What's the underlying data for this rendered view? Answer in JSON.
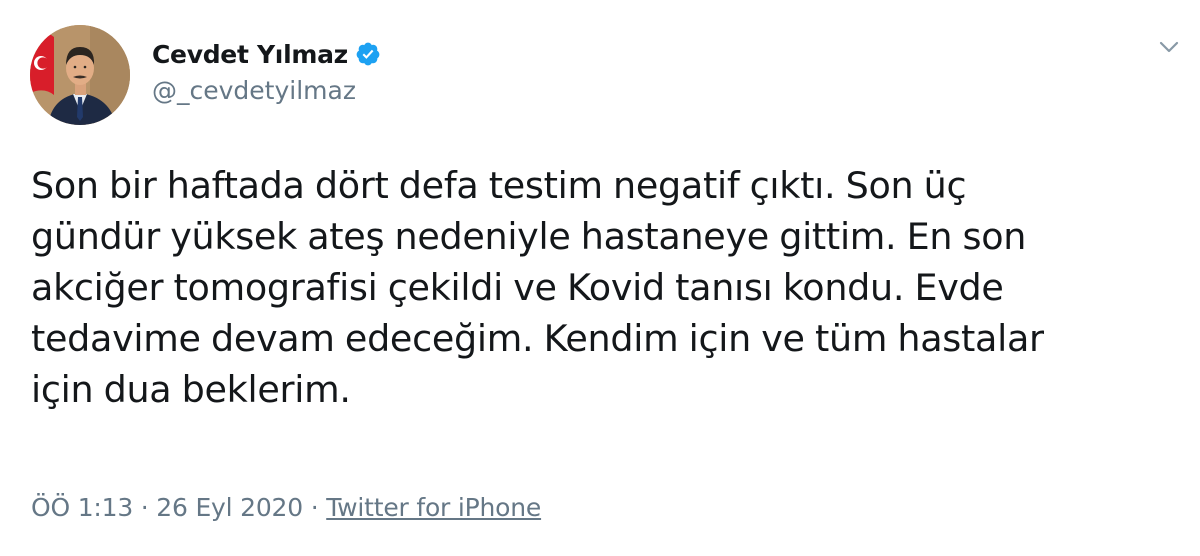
{
  "author": {
    "display_name": "Cevdet Yılmaz",
    "handle": "@_cevdetyilmaz",
    "verified": true,
    "avatar_icon": "user-avatar-photo"
  },
  "tweet": {
    "text": "Son bir haftada dört defa testim negatif çıktı. Son üç\ngündür yüksek ateş nedeniyle hastaneye gittim. En son\nakciğer tomografisi çekildi ve Kovid tanısı kondu. Evde\ntedavime devam edeceğim. Kendim için ve tüm hastalar\niçin dua beklerim."
  },
  "meta": {
    "time": "ÖÖ 1:13",
    "separator_1": " · ",
    "date": "26 Eyl 2020",
    "separator_2": " · ",
    "source": "Twitter for iPhone"
  },
  "icons": {
    "verified": "verified-badge-icon",
    "menu": "chevron-down-icon"
  },
  "colors": {
    "text": "#14171a",
    "secondary": "#657786",
    "verified_blue": "#1da1f2"
  }
}
